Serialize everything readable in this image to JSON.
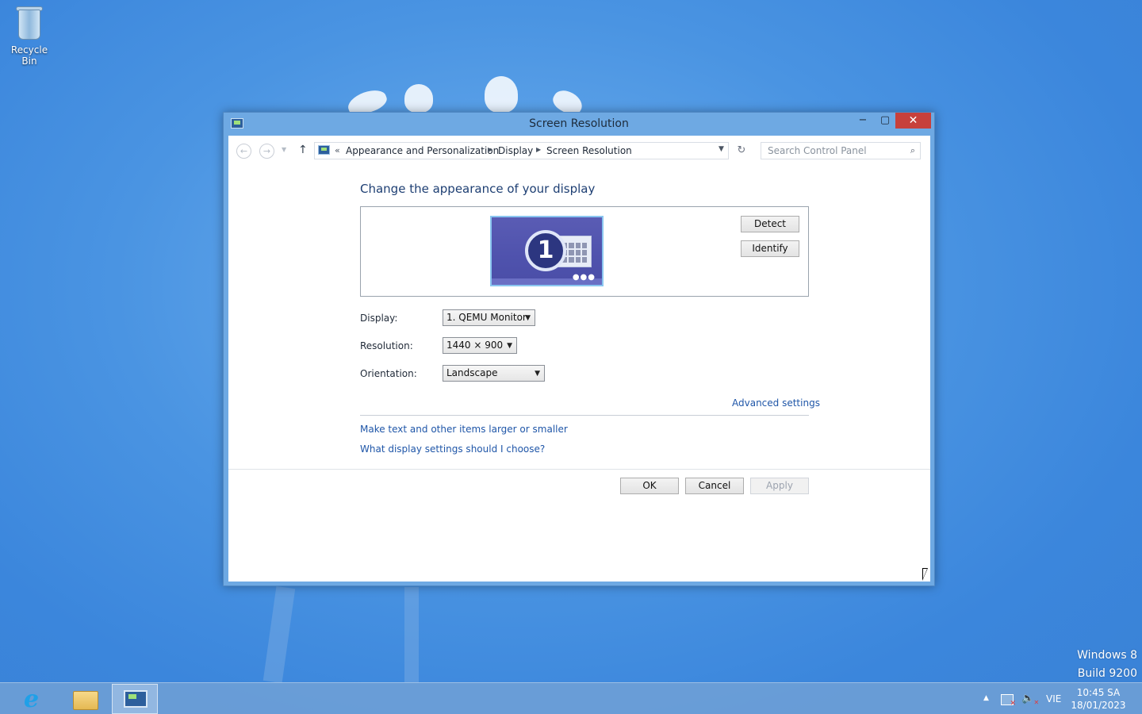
{
  "desktop": {
    "recycle_bin_label": "Recycle Bin",
    "watermark_line1": "Windows 8",
    "watermark_line2": "Build 9200"
  },
  "window": {
    "title": "Screen Resolution",
    "minimize": "−",
    "maximize": "▢",
    "close": "✕",
    "address": {
      "overflow": "«",
      "crumbs": [
        "Appearance and Personalization",
        "Display",
        "Screen Resolution"
      ]
    },
    "search": {
      "placeholder": "Search Control Panel"
    },
    "heading": "Change the appearance of your display",
    "monitor_number": "1",
    "detect_label": "Detect",
    "identify_label": "Identify",
    "fields": {
      "display_label": "Display:",
      "display_value": "1. QEMU Monitor",
      "resolution_label": "Resolution:",
      "resolution_value": "1440 × 900",
      "orientation_label": "Orientation:",
      "orientation_value": "Landscape"
    },
    "advanced_link": "Advanced settings",
    "links": [
      "Make text and other items larger or smaller",
      "What display settings should I choose?"
    ],
    "ok_label": "OK",
    "cancel_label": "Cancel",
    "apply_label": "Apply"
  },
  "taskbar": {
    "apps": [
      "internet-explorer-icon",
      "file-explorer-icon",
      "control-panel-icon"
    ],
    "language": "VIE",
    "time": "10:45 SA",
    "date": "18/01/2023"
  }
}
